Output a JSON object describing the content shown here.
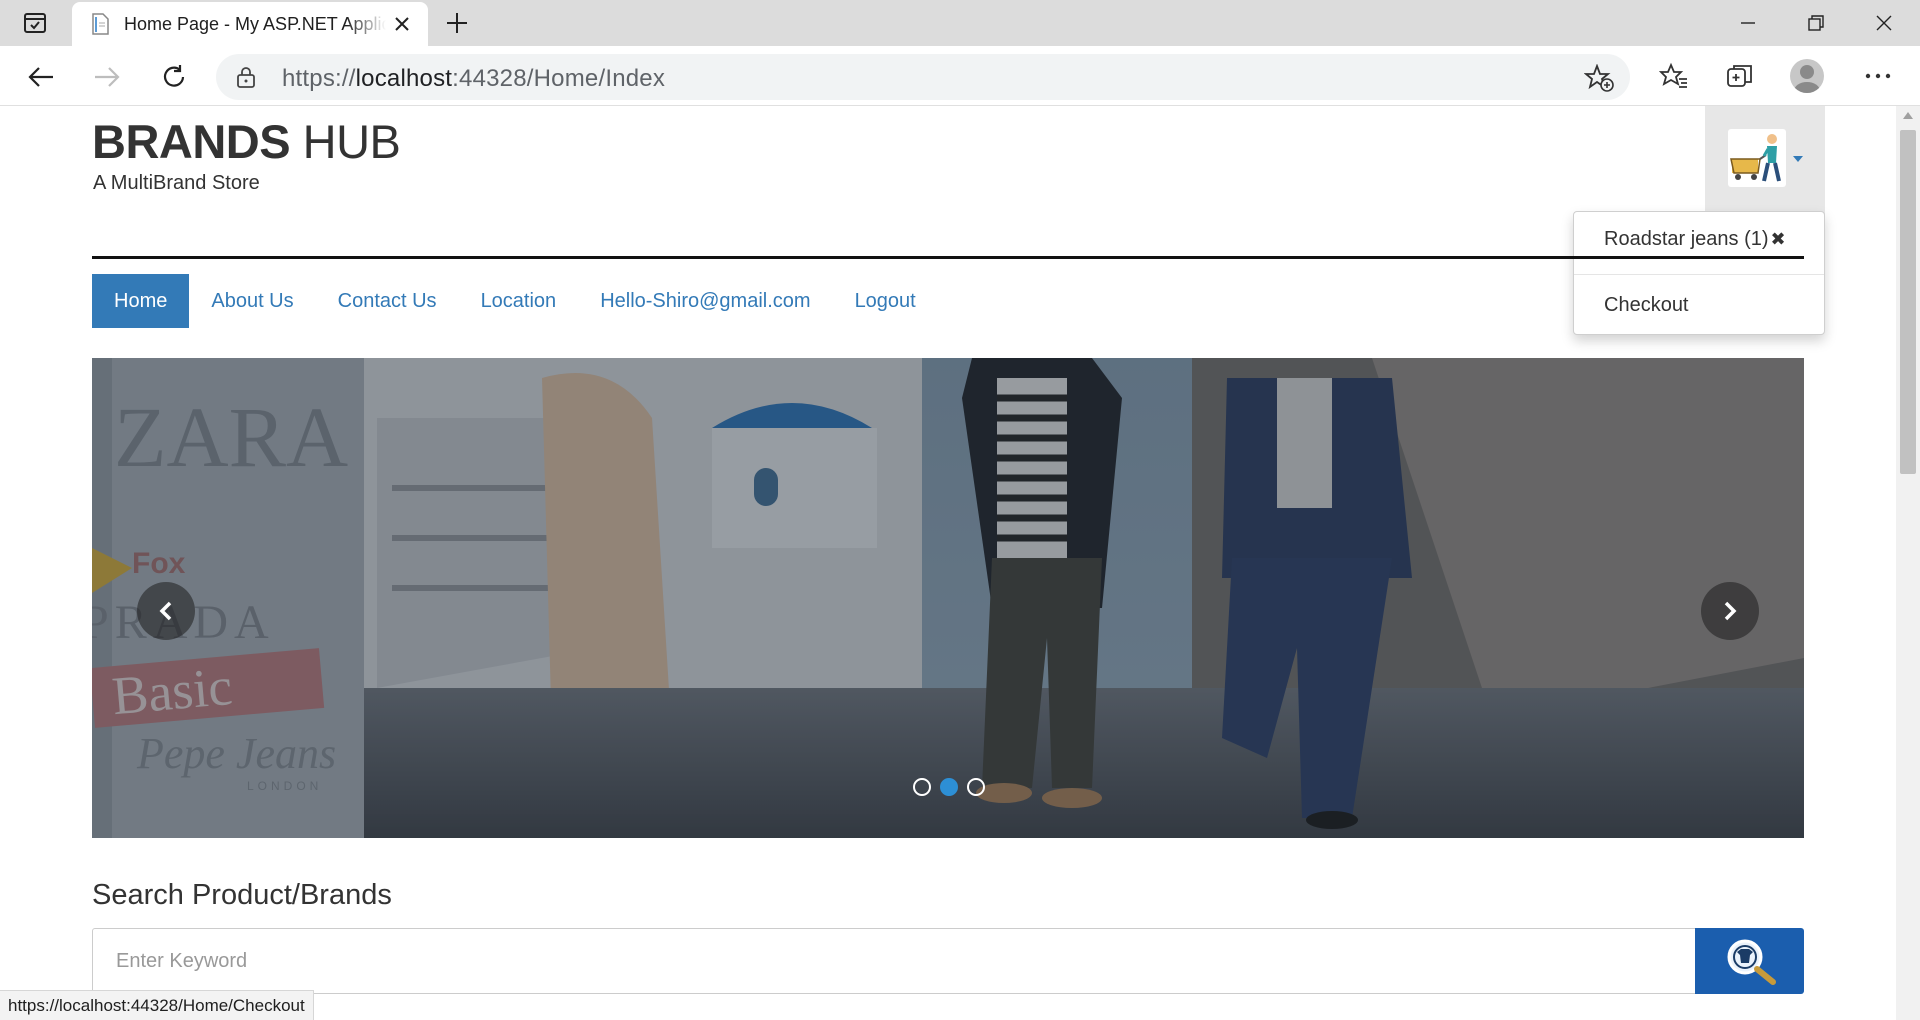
{
  "browser": {
    "tab_title": "Home Page - My ASP.NET Application",
    "url_prefix": "https://",
    "url_host": "localhost",
    "url_rest": ":44328/Home/Index",
    "status_url": "https://localhost:44328/Home/Checkout"
  },
  "header": {
    "brand_bold": "BRANDS",
    "brand_rest": " HUB",
    "tagline": "A MultiBrand Store"
  },
  "nav": {
    "items": [
      "Home",
      "About Us",
      "Contact Us",
      "Location",
      "Hello-Shiro@gmail.com",
      "Logout"
    ],
    "active": "Home"
  },
  "cart": {
    "item": "Roadstar jeans (1)",
    "remove_glyph": "✖",
    "checkout": "Checkout"
  },
  "carousel": {
    "slide_count": 3,
    "active_index": 1,
    "brand_text": [
      "ZARA",
      "Fox",
      "PRADA",
      "Basic",
      "Pepe Jeans",
      "LONDON"
    ]
  },
  "search": {
    "title": "Search Product/Brands",
    "placeholder": "Enter Keyword",
    "value": ""
  },
  "colors": {
    "accent": "#337ab7",
    "search_button": "#1b5eae",
    "indicator_active": "#2d8fd5"
  },
  "icons": {
    "tab_actions": "tab-actions-icon",
    "favicon": "page-icon",
    "close": "close-icon",
    "new_tab": "plus-icon",
    "back": "arrow-left-icon",
    "forward": "arrow-right-icon",
    "refresh": "refresh-icon",
    "lock": "lock-icon",
    "add_favorite": "star-add-icon",
    "favorites": "favorites-icon",
    "collections": "collections-icon",
    "more": "more-icon",
    "cart": "shopping-cart-icon",
    "search": "magnifier-icon"
  }
}
